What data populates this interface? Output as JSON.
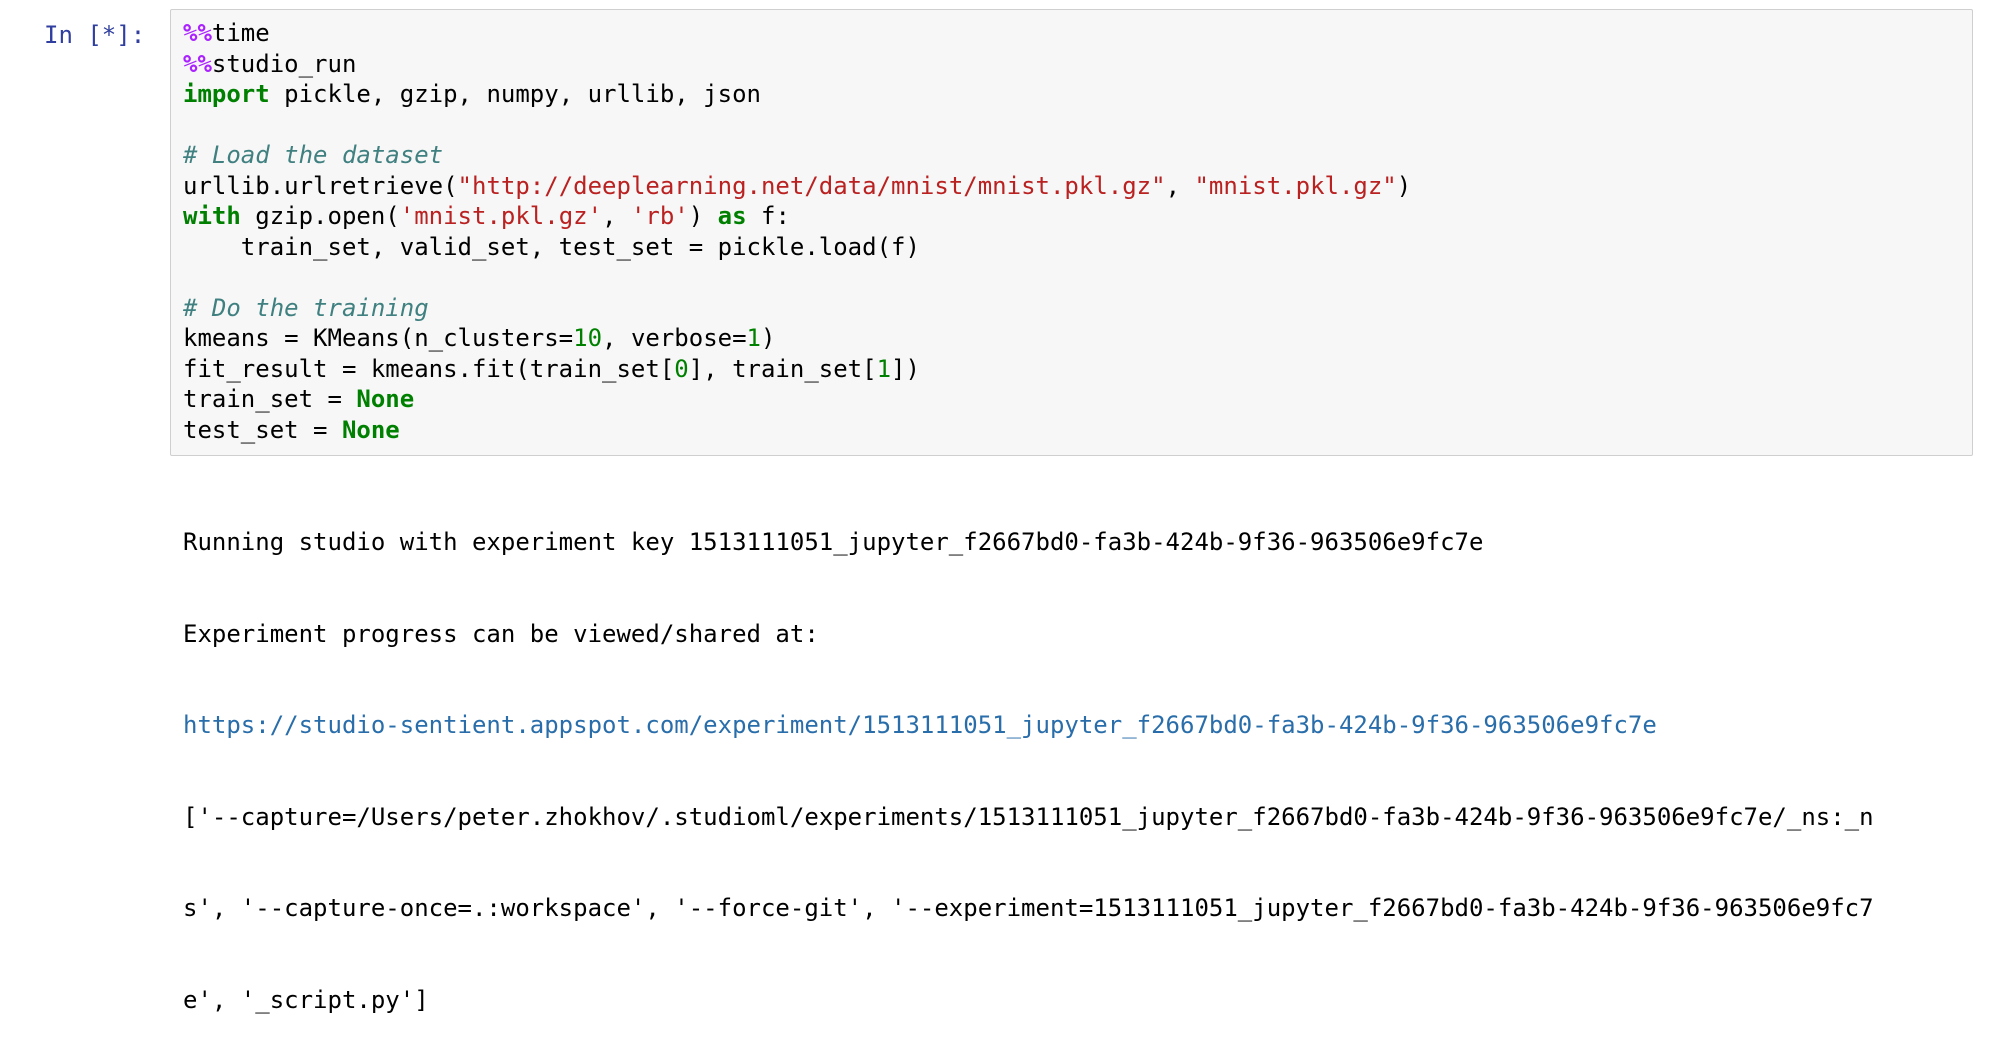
{
  "cell": {
    "prompt": "In [*]:",
    "code_lines": [
      [
        {
          "t": "%%",
          "k": "magic"
        },
        {
          "t": "time",
          "k": "text"
        }
      ],
      [
        {
          "t": "%%",
          "k": "magic"
        },
        {
          "t": "studio_run",
          "k": "text"
        }
      ],
      [
        {
          "t": "import",
          "k": "keyword"
        },
        {
          "t": " pickle, gzip, numpy, urllib, json",
          "k": "text"
        }
      ],
      [],
      [
        {
          "t": "# Load the dataset",
          "k": "comment"
        }
      ],
      [
        {
          "t": "urllib.urlretrieve(",
          "k": "text"
        },
        {
          "t": "\"http://deeplearning.net/data/mnist/mnist.pkl.gz\"",
          "k": "string"
        },
        {
          "t": ", ",
          "k": "text"
        },
        {
          "t": "\"mnist.pkl.gz\"",
          "k": "string"
        },
        {
          "t": ")",
          "k": "text"
        }
      ],
      [
        {
          "t": "with",
          "k": "keyword"
        },
        {
          "t": " gzip.open(",
          "k": "text"
        },
        {
          "t": "'mnist.pkl.gz'",
          "k": "string"
        },
        {
          "t": ", ",
          "k": "text"
        },
        {
          "t": "'rb'",
          "k": "string"
        },
        {
          "t": ") ",
          "k": "text"
        },
        {
          "t": "as",
          "k": "keyword"
        },
        {
          "t": " f:",
          "k": "text"
        }
      ],
      [
        {
          "t": "    train_set, valid_set, test_set = pickle.load(f)",
          "k": "text"
        }
      ],
      [],
      [
        {
          "t": "# Do the training",
          "k": "comment"
        }
      ],
      [
        {
          "t": "kmeans = KMeans(n_clusters=",
          "k": "text"
        },
        {
          "t": "10",
          "k": "number"
        },
        {
          "t": ", verbose=",
          "k": "text"
        },
        {
          "t": "1",
          "k": "number"
        },
        {
          "t": ")",
          "k": "text"
        }
      ],
      [
        {
          "t": "fit_result = kmeans.fit(train_set[",
          "k": "text"
        },
        {
          "t": "0",
          "k": "number"
        },
        {
          "t": "], train_set[",
          "k": "text"
        },
        {
          "t": "1",
          "k": "number"
        },
        {
          "t": "])",
          "k": "text"
        }
      ],
      [
        {
          "t": "train_set = ",
          "k": "text"
        },
        {
          "t": "None",
          "k": "keyword"
        }
      ],
      [
        {
          "t": "test_set = ",
          "k": "text"
        },
        {
          "t": "None",
          "k": "keyword"
        }
      ]
    ]
  },
  "output": {
    "line1": "Running studio with experiment key 1513111051_jupyter_f2667bd0-fa3b-424b-9f36-963506e9fc7e",
    "line2": "Experiment progress can be viewed/shared at:",
    "link": "https://studio-sentient.appspot.com/experiment/1513111051_jupyter_f2667bd0-fa3b-424b-9f36-963506e9fc7e",
    "args_lines": [
      "['--capture=/Users/peter.zhokhov/.studioml/experiments/1513111051_jupyter_f2667bd0-fa3b-424b-9f36-963506e9fc7e/_ns:_n",
      "s', '--capture-once=.:workspace', '--force-git', '--experiment=1513111051_jupyter_f2667bd0-fa3b-424b-9f36-963506e9fc7",
      "e', '_script.py']"
    ]
  },
  "colors": {
    "magic": "#aa22ff",
    "keyword": "#008000",
    "comment": "#408080",
    "string": "#ba2121",
    "number": "#008000",
    "text": "#000000",
    "prompt": "#303f9f",
    "link": "#296eaa"
  }
}
